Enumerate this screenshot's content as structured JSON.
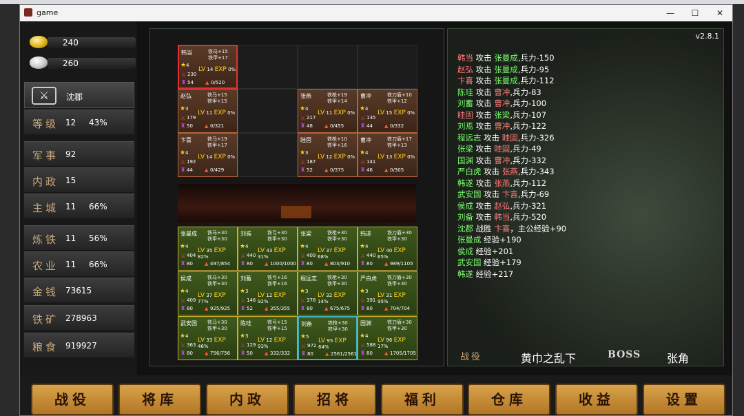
{
  "window": {
    "title": "game",
    "minimize": "—",
    "maximize": "☐",
    "close": "✕"
  },
  "resources": [
    {
      "icon": "gold-ingot-icon",
      "value": "240"
    },
    {
      "icon": "silver-ingot-icon",
      "value": "260"
    }
  ],
  "lord": {
    "name": "沈郡"
  },
  "stats": [
    {
      "label": "等级",
      "value": "12",
      "pct": "43%"
    },
    {
      "label": "军事",
      "value": "92",
      "pct": ""
    },
    {
      "label": "内政",
      "value": "15",
      "pct": ""
    },
    {
      "label": "主城",
      "value": "11",
      "pct": "66%"
    },
    {
      "label": "炼铁",
      "value": "11",
      "pct": "56%"
    },
    {
      "label": "农业",
      "value": "11",
      "pct": "66%"
    },
    {
      "label": "金钱",
      "value": "73615",
      "pct": ""
    },
    {
      "label": "铁矿",
      "value": "278963",
      "pct": ""
    },
    {
      "label": "粮食",
      "value": "919927",
      "pct": ""
    }
  ],
  "enemies": [
    {
      "name": "韩当",
      "t1": "铁马+15",
      "t2": "铁甲+17",
      "stars": "4",
      "lv": "14",
      "exp": "0%",
      "atk": "230",
      "def": "54",
      "troops": "0/520"
    },
    {
      "name": "赵弘",
      "t1": "铁马+15",
      "t2": "铁甲+15",
      "stars": "3",
      "lv": "11",
      "exp": "0%",
      "atk": "179",
      "def": "50",
      "troops": "0/321"
    },
    {
      "name": "张燕",
      "t1": "铁枪+19",
      "t2": "铁甲+14",
      "stars": "4",
      "lv": "11",
      "exp": "0%",
      "atk": "217",
      "def": "48",
      "troops": "0/455"
    },
    {
      "name": "曹冲",
      "t1": "铁刀盾+10",
      "t2": "铁甲+12",
      "stars": "4",
      "lv": "15",
      "exp": "0%",
      "atk": "135",
      "def": "44",
      "troops": "0/332"
    },
    {
      "name": "卞喜",
      "t1": "铁马+19",
      "t2": "铁甲+17",
      "stars": "4",
      "lv": "14",
      "exp": "0%",
      "atk": "192",
      "def": "44",
      "troops": "0/429"
    },
    {
      "name": "眭固",
      "t1": "铁枪+10",
      "t2": "铁甲+16",
      "stars": "3",
      "lv": "12",
      "exp": "0%",
      "atk": "187",
      "def": "52",
      "troops": "0/375"
    },
    {
      "name": "曹冲",
      "t1": "铁刀盾+17",
      "t2": "铁甲+13",
      "stars": "4",
      "lv": "13",
      "exp": "0%",
      "atk": "141",
      "def": "46",
      "troops": "0/305"
    }
  ],
  "allies": [
    {
      "name": "张曼成",
      "t1": "铁马+30",
      "t2": "铁甲+30",
      "stars": "4",
      "lv": "35",
      "exp": "82%",
      "atk": "404",
      "def": "80",
      "troops": "497/854"
    },
    {
      "name": "刘焉",
      "t1": "铁弓+30",
      "t2": "铁甲+30",
      "stars": "4",
      "lv": "43",
      "exp": "31%",
      "atk": "440",
      "def": "80",
      "troops": "1000/1000"
    },
    {
      "name": "张梁",
      "t1": "铁枪+30",
      "t2": "铁甲+30",
      "stars": "4",
      "lv": "37",
      "exp": "68%",
      "atk": "409",
      "def": "80",
      "troops": "803/910"
    },
    {
      "name": "韩遂",
      "t1": "铁刀盾+30",
      "t2": "铁甲+30",
      "stars": "4",
      "lv": "40",
      "exp": "65%",
      "atk": "440",
      "def": "80",
      "troops": "989/1105"
    },
    {
      "name": "侯成",
      "t1": "铁马+30",
      "t2": "铁甲+30",
      "stars": "4",
      "lv": "37",
      "exp": "77%",
      "atk": "409",
      "def": "80",
      "troops": "925/925"
    },
    {
      "name": "刘蓄",
      "t1": "铁弓+16",
      "t2": "铁甲+16",
      "stars": "3",
      "lv": "12",
      "exp": "92%",
      "atk": "146",
      "def": "52",
      "troops": "355/355"
    },
    {
      "name": "程远志",
      "t1": "铁枪+30",
      "t2": "铁甲+30",
      "stars": "3",
      "lv": "32",
      "exp": "14%",
      "atk": "378",
      "def": "80",
      "troops": "675/675"
    },
    {
      "name": "严白虎",
      "t1": "铁刀盾+30",
      "t2": "铁甲+30",
      "stars": "3",
      "lv": "31",
      "exp": "95%",
      "atk": "391",
      "def": "80",
      "troops": "704/704"
    },
    {
      "name": "武安国",
      "t1": "铁马+30",
      "t2": "铁甲+30",
      "stars": "4",
      "lv": "33",
      "exp": "46%",
      "atk": "363",
      "def": "80",
      "troops": "756/756"
    },
    {
      "name": "陈珪",
      "t1": "铁弓+15",
      "t2": "铁甲+15",
      "stars": "3",
      "lv": "12",
      "exp": "93%",
      "atk": "129",
      "def": "50",
      "troops": "332/332"
    },
    {
      "name": "刘备",
      "t1": "铁枪+30",
      "t2": "铁甲+30",
      "stars": "5",
      "lv": "95",
      "exp": "64%",
      "atk": "972",
      "def": "80",
      "troops": "2561/2561"
    },
    {
      "name": "国渊",
      "t1": "铁刀盾+30",
      "t2": "铁甲+30",
      "stars": "4",
      "lv": "96",
      "exp": "17%",
      "atk": "588",
      "def": "80",
      "troops": "1705/1705"
    }
  ],
  "card_labels": {
    "lv": "LV",
    "exp": "EXP"
  },
  "version": "v2.8.1",
  "log": [
    {
      "a": "韩当",
      "mid": " 攻击 ",
      "b": "张曼成",
      "rest": ",兵力-150",
      "kind": "enemy"
    },
    {
      "a": "赵弘",
      "mid": " 攻击 ",
      "b": "张曼成",
      "rest": ",兵力-95",
      "kind": "enemy"
    },
    {
      "a": "卞喜",
      "mid": " 攻击 ",
      "b": "张曼成",
      "rest": ",兵力-112",
      "kind": "enemy"
    },
    {
      "a": "陈珪",
      "mid": " 攻击 ",
      "b": "曹冲",
      "rest": ",兵力-83",
      "kind": "ally"
    },
    {
      "a": "刘蓄",
      "mid": " 攻击 ",
      "b": "曹冲",
      "rest": ",兵力-100",
      "kind": "ally"
    },
    {
      "a": "眭固",
      "mid": " 攻击 ",
      "b": "张梁",
      "rest": ",兵力-107",
      "kind": "enemy"
    },
    {
      "a": "刘焉",
      "mid": " 攻击 ",
      "b": "曹冲",
      "rest": ",兵力-122",
      "kind": "ally"
    },
    {
      "a": "程远志",
      "mid": " 攻击 ",
      "b": "眭固",
      "rest": ",兵力-326",
      "kind": "ally"
    },
    {
      "a": "张梁",
      "mid": " 攻击 ",
      "b": "眭固",
      "rest": ",兵力-49",
      "kind": "ally"
    },
    {
      "a": "国渊",
      "mid": " 攻击 ",
      "b": "曹冲",
      "rest": ",兵力-332",
      "kind": "ally"
    },
    {
      "a": "严白虎",
      "mid": " 攻击 ",
      "b": "张燕",
      "rest": ",兵力-343",
      "kind": "ally"
    },
    {
      "a": "韩遂",
      "mid": " 攻击 ",
      "b": "张燕",
      "rest": ",兵力-112",
      "kind": "ally"
    },
    {
      "a": "武安国",
      "mid": " 攻击 ",
      "b": "卞喜",
      "rest": ",兵力-69",
      "kind": "ally"
    },
    {
      "a": "侯成",
      "mid": " 攻击 ",
      "b": "赵弘",
      "rest": ",兵力-321",
      "kind": "ally"
    },
    {
      "a": "刘备",
      "mid": " 攻击 ",
      "b": "韩当",
      "rest": ",兵力-520",
      "kind": "ally"
    },
    {
      "a": "沈郡",
      "mid": " 战胜 ",
      "b": "卞喜",
      "rest": "，主公经验+90",
      "kind": "ally"
    },
    {
      "a": "张曼成",
      "mid": " 经验+190",
      "b": "",
      "rest": "",
      "kind": "ally"
    },
    {
      "a": "侯成",
      "mid": " 经验+201",
      "b": "",
      "rest": "",
      "kind": "ally"
    },
    {
      "a": "武安国",
      "mid": " 经验+179",
      "b": "",
      "rest": "",
      "kind": "ally"
    },
    {
      "a": "韩遂",
      "mid": " 经验+217",
      "b": "",
      "rest": "",
      "kind": "ally"
    }
  ],
  "battle": {
    "label": "战役",
    "stage": "黄巾之乱下",
    "boss_label": "BOSS",
    "boss_name": "张角"
  },
  "nav": [
    "战役",
    "将库",
    "内政",
    "招将",
    "福利",
    "仓库",
    "收益",
    "设置"
  ]
}
